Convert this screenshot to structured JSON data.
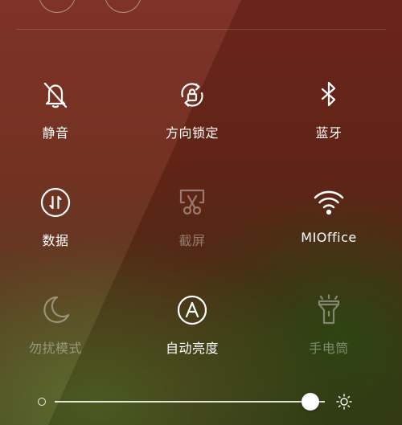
{
  "toggles": [
    {
      "label": "静音",
      "icon": "bell-off-icon",
      "enabled": true
    },
    {
      "label": "方向锁定",
      "icon": "rotation-lock-icon",
      "enabled": true
    },
    {
      "label": "蓝牙",
      "icon": "bluetooth-icon",
      "enabled": true
    },
    {
      "label": "数据",
      "icon": "mobile-data-icon",
      "enabled": true
    },
    {
      "label": "截屏",
      "icon": "screenshot-scissors-icon",
      "enabled": false
    },
    {
      "label": "MIOffice",
      "icon": "wifi-icon",
      "enabled": true
    },
    {
      "label": "勿扰模式",
      "icon": "moon-icon",
      "enabled": false
    },
    {
      "label": "自动亮度",
      "icon": "auto-brightness-icon",
      "enabled": true
    },
    {
      "label": "手电筒",
      "icon": "flashlight-icon",
      "enabled": false
    }
  ],
  "brightness": {
    "level": 0.945,
    "min_icon": "dim-sun-icon",
    "max_icon": "sun-icon"
  },
  "colors": {
    "active": "#ffffff",
    "inactive": "rgba(255,255,255,0.38)"
  }
}
